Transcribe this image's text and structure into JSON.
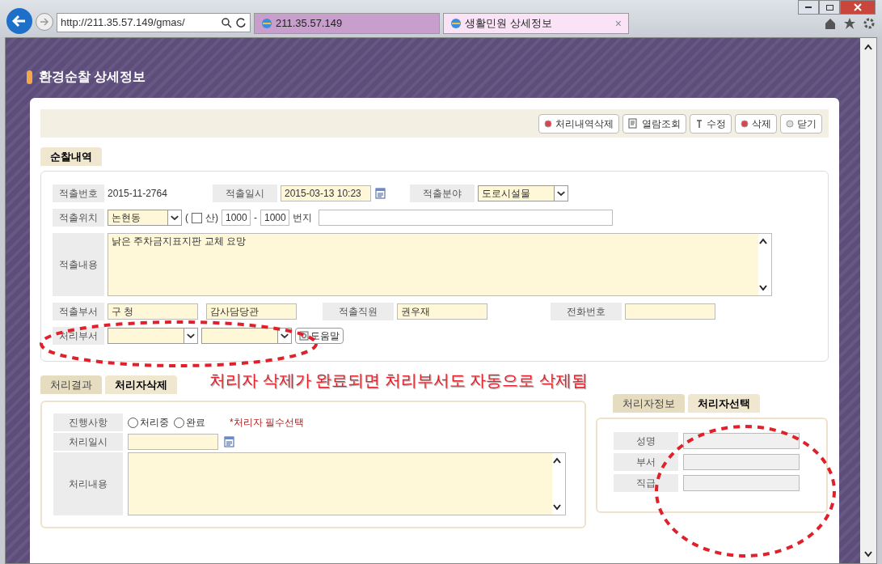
{
  "browser": {
    "address": "http://211.35.57.149/gmas/",
    "tabs": [
      {
        "label": "211.35.57.149",
        "selected": false
      },
      {
        "label": "생활민원 상세정보",
        "selected": true,
        "close": "×"
      }
    ]
  },
  "page": {
    "title": "환경순찰 상세정보"
  },
  "toolbar": {
    "buttons": [
      {
        "label": "처리내역삭제",
        "kind": "delete"
      },
      {
        "label": "열람조회",
        "kind": "view"
      },
      {
        "label": "수정",
        "kind": "edit"
      },
      {
        "label": "삭제",
        "kind": "delete"
      },
      {
        "label": "닫기",
        "kind": "close"
      }
    ]
  },
  "section_tabs": [
    {
      "label": "순찰내역",
      "selected": true
    }
  ],
  "patrol": {
    "number_label": "적출번호",
    "number": "2015-11-2764",
    "datetime_label": "적출일시",
    "datetime": "2015-03-13  10:23",
    "field_label": "적출분야",
    "field": "도로시설물",
    "location_label": "적출위치",
    "location": "논현동",
    "mountain_label": "산)",
    "mountain_checked": false,
    "open_paren": "(",
    "lot_main": "1000",
    "dash": "-",
    "lot_sub": "1000",
    "lot_unit": "번지",
    "content_label": "적출내용",
    "content": "낡은 주차금지표지판 교체 요망",
    "dept_label": "적출부서",
    "dept_1": "구 청",
    "dept_2": "감사담당관",
    "staff_label": "적출직원",
    "staff": "권우재",
    "phone_label": "전화번호",
    "handling_dept_label": "처리부서",
    "help_button": "도움말"
  },
  "annotation": "처리자 삭제가 완료되면 처리부서도 자동으로 삭제됨",
  "result_tabs": [
    {
      "label": "처리결과",
      "selected": false
    },
    {
      "label": "처리자삭제",
      "selected": true
    }
  ],
  "result": {
    "progress_label": "진행사항",
    "options": [
      {
        "label": "처리중",
        "selected": false
      },
      {
        "label": "완료",
        "selected": false
      }
    ],
    "required_note": "*처리자 필수선택",
    "date_label": "처리일시",
    "content_label": "처리내용"
  },
  "handler_tabs": [
    {
      "label": "처리자정보",
      "selected": false
    },
    {
      "label": "처리자선택",
      "selected": true
    }
  ],
  "handler": {
    "fields": [
      {
        "label": "성명"
      },
      {
        "label": "부서"
      },
      {
        "label": "직급"
      }
    ]
  }
}
